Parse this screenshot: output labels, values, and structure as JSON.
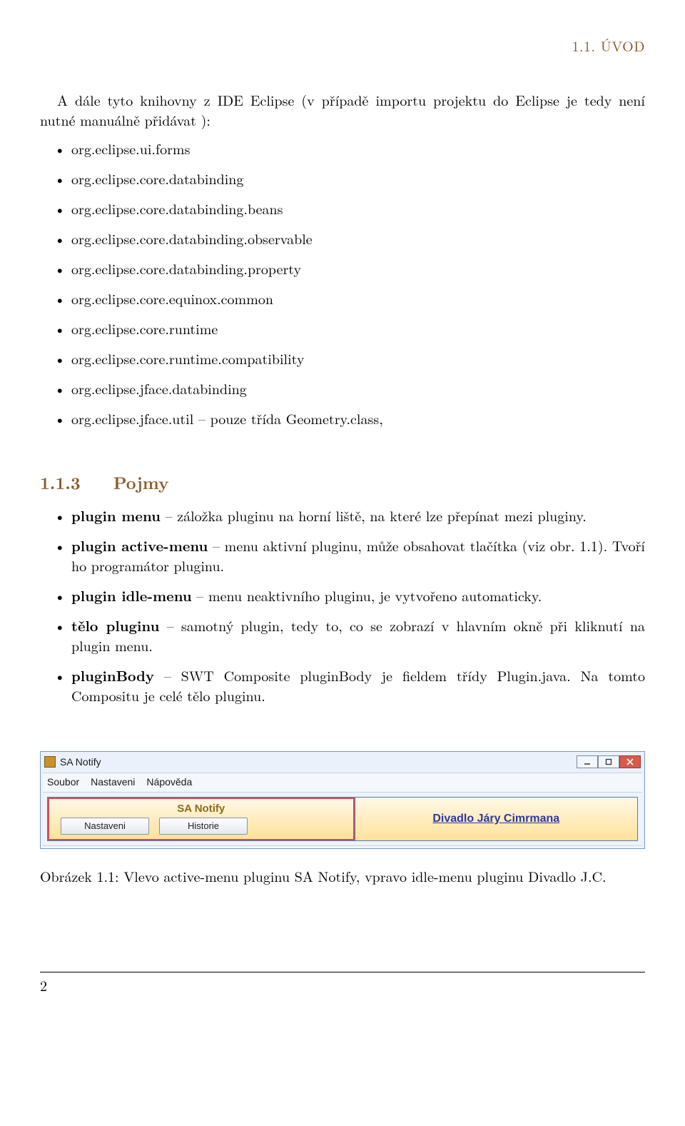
{
  "header": {
    "running": "1.1. ÚVOD"
  },
  "intro": "A dále tyto knihovny z IDE Eclipse (v případě importu projektu do Eclipse je tedy není nutné manuálně přidávat ):",
  "libs": [
    "org.eclipse.ui.forms",
    "org.eclipse.core.databinding",
    "org.eclipse.core.databinding.beans",
    "org.eclipse.core.databinding.observable",
    "org.eclipse.core.databinding.property",
    "org.eclipse.core.equinox.common",
    "org.eclipse.core.runtime",
    "org.eclipse.core.runtime.compatibility",
    "org.eclipse.jface.databinding",
    "org.eclipse.jface.util – pouze třída Geometry.class,"
  ],
  "section": {
    "num": "1.1.3",
    "title": "Pojmy"
  },
  "terms": [
    {
      "name": "plugin menu",
      "desc": " – záložka pluginu na horní liště, na které lze přepínat mezi pluginy."
    },
    {
      "name": "plugin active-menu",
      "desc": " – menu aktivní pluginu, může obsahovat tlačítka (viz obr. 1.1). Tvoří ho programátor pluginu."
    },
    {
      "name": "plugin idle-menu",
      "desc": " – menu neaktivního pluginu, je vytvořeno automaticky."
    },
    {
      "name": "tělo pluginu",
      "desc": " – samotný plugin, tedy to, co se zobrazí v hlavním okně při kliknutí na plugin menu."
    },
    {
      "name": "pluginBody",
      "desc": " – SWT Composite pluginBody je fieldem třídy Plugin.java. Na tomto Compositu je celé tělo pluginu."
    }
  ],
  "figure": {
    "window_title": "SA Notify",
    "menus": [
      "Soubor",
      "Nastaveni",
      "Nápověda"
    ],
    "active_tab_title": "SA Notify",
    "buttons": [
      "Nastaveni",
      "Historie"
    ],
    "idle_tab": "Divadlo Járy Cimrmana",
    "caption": "Obrázek 1.1: Vlevo active-menu pluginu SA Notify, vpravo idle-menu pluginu Divadlo J.C."
  },
  "page_number": "2"
}
